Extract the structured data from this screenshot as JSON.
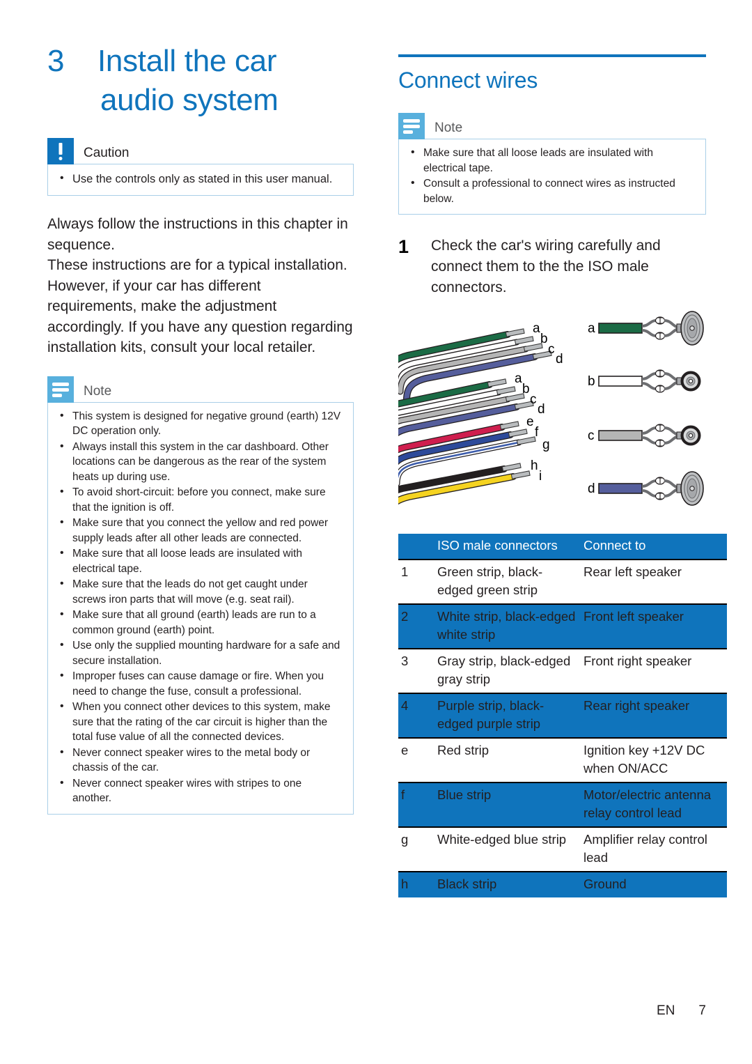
{
  "chapter": {
    "number": "3",
    "title_line1": "Install the car",
    "title_line2": "audio system"
  },
  "caution": {
    "icon": "exclamation-icon",
    "label": "Caution",
    "items": [
      "Use the controls only as stated in this user manual."
    ]
  },
  "intro": {
    "paragraph1": "Always follow the instructions in this chapter in sequence.",
    "paragraph2": "These instructions are for a typical installation. However, if your car has different requirements, make the adjustment accordingly. If you have any question regarding installation kits, consult your local retailer."
  },
  "note_left": {
    "icon": "note-lines-icon",
    "label": "Note",
    "items": [
      "This system is designed for negative ground (earth) 12V DC operation only.",
      "Always install this system in the car dashboard. Other locations can be dangerous as the rear of the system heats up during use.",
      "To avoid short-circuit: before you connect, make sure that the ignition is off.",
      "Make sure that you connect the yellow and red power supply leads after all other leads are connected.",
      "Make sure that all loose leads are insulated with electrical tape.",
      "Make sure that the leads do not get caught under screws iron parts that will move (e.g. seat rail).",
      "Make sure that all ground (earth) leads are run to a common ground (earth) point.",
      "Use only the supplied mounting hardware for a safe and secure installation.",
      "Improper fuses can cause damage or fire. When you need to change the fuse, consult a professional.",
      "When you connect other devices to this system, make sure that the rating of the car circuit is higher than the total fuse value of all the connected devices.",
      "Never connect speaker wires to the metal body or chassis of the car.",
      "Never connect speaker wires with stripes to one another."
    ]
  },
  "section": {
    "title": "Connect wires"
  },
  "note_right": {
    "icon": "note-lines-icon",
    "label": "Note",
    "items": [
      "Make sure that all loose leads are insulated with electrical tape.",
      "Consult a professional to connect wires as instructed below."
    ]
  },
  "step1": {
    "number": "1",
    "text": "Check the car's wiring carefully and connect them to the the ISO male connectors."
  },
  "diagram": {
    "harness_labels_group1": [
      "a",
      "b",
      "c",
      "d"
    ],
    "harness_labels_group2": [
      "a",
      "b",
      "c",
      "d"
    ],
    "harness_labels_group3": [
      "e",
      "f",
      "g"
    ],
    "harness_labels_group4": [
      "h",
      "i"
    ],
    "speakers": [
      {
        "label_left": "a",
        "label_right": "a",
        "wire_color": "#1b6b45",
        "size": "large"
      },
      {
        "label_left": "b",
        "label_right": "b",
        "wire_color": "#ffffff",
        "size": "small"
      },
      {
        "label_left": "c",
        "label_right": "c",
        "wire_color": "#b5b5b5",
        "size": "small"
      },
      {
        "label_left": "d",
        "label_right": "d",
        "wire_color": "#555e9c",
        "size": "large"
      }
    ],
    "wire_colors": {
      "green": "#1b6b45",
      "white": "#ffffff",
      "gray": "#b5b5b5",
      "purple": "#555e9c",
      "red": "#cf1e4e",
      "blue": "#2d4a9a",
      "white_edged_blue": "#3b5bab",
      "black": "#231f20",
      "yellow": "#f5d320"
    }
  },
  "table": {
    "headers": [
      "",
      "ISO male connectors",
      "Connect to"
    ],
    "rows": [
      {
        "idx": "1",
        "iso": "Green strip, black-edged green strip",
        "connect": "Rear left speaker",
        "highlight": false
      },
      {
        "idx": "2",
        "iso": "White strip, black-edged white strip",
        "connect": "Front left speaker",
        "highlight": true
      },
      {
        "idx": "3",
        "iso": "Gray strip, black-edged gray strip",
        "connect": "Front right speaker",
        "highlight": false
      },
      {
        "idx": "4",
        "iso": "Purple strip, black-edged purple strip",
        "connect": "Rear right speaker",
        "highlight": true
      },
      {
        "idx": "e",
        "iso": "Red strip",
        "connect": "Ignition key +12V DC when ON/ACC",
        "highlight": false
      },
      {
        "idx": "f",
        "iso": "Blue strip",
        "connect": "Motor/electric antenna relay control lead",
        "highlight": true
      },
      {
        "idx": "g",
        "iso": "White-edged blue strip",
        "connect": "Amplifier relay control lead",
        "highlight": false
      },
      {
        "idx": "h",
        "iso": "Black strip",
        "connect": "Ground",
        "highlight": true
      }
    ]
  },
  "footer": {
    "language": "EN",
    "page": "7"
  },
  "colors": {
    "brand_blue": "#0f74bc",
    "note_blue": "#58b0dd",
    "box_border": "#a9cfe8"
  }
}
